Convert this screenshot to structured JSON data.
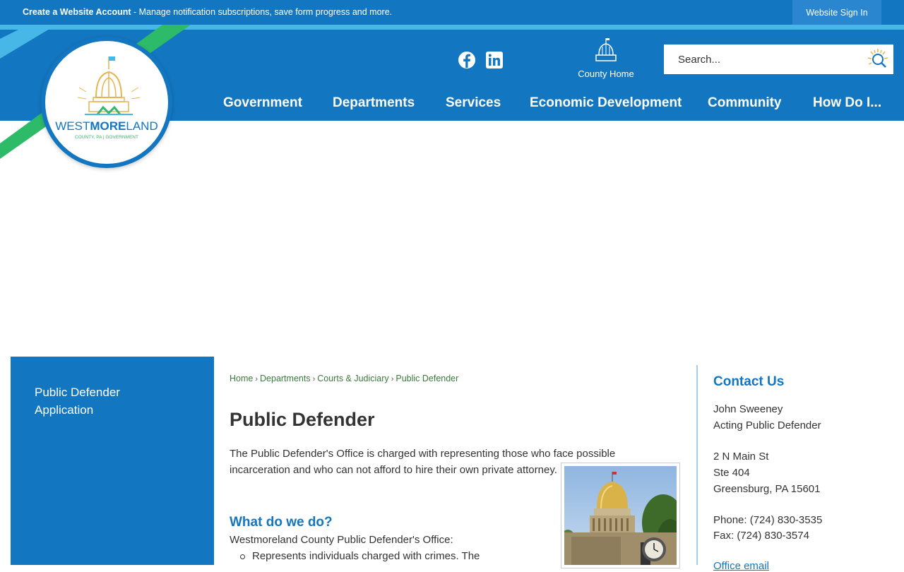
{
  "topbar": {
    "create_account": "Create a Website Account",
    "create_account_desc": " - Manage notification subscriptions, save form progress and more.",
    "sign_in": "Website Sign In"
  },
  "header": {
    "logo_text_west": "WEST",
    "logo_text_more": "MORE",
    "logo_text_land": "LAND",
    "logo_subtitle": "COUNTY, PA | GOVERNMENT",
    "social": [
      "facebook-icon",
      "linkedin-icon"
    ],
    "county_home_label": "County Home",
    "search_placeholder": "Search...",
    "nav": [
      "Government",
      "Departments",
      "Services",
      "Economic Development",
      "Community",
      "How Do I..."
    ]
  },
  "sidebar": {
    "items": [
      {
        "label": "Public Defender Application"
      }
    ]
  },
  "breadcrumb": [
    "Home",
    "Departments",
    "Courts & Judiciary",
    "Public Defender"
  ],
  "main": {
    "title": "Public Defender",
    "intro": "The Public Defender's Office is charged with representing those who face possible incarceration and who can not afford to hire their own private attorney.",
    "section_heading": "What do we do?",
    "office_line": "Westmoreland County Public Defender's Office:",
    "bullets": [
      "Represents individuals charged with crimes. The"
    ]
  },
  "contact": {
    "heading": "Contact Us",
    "name": "John Sweeney",
    "role": "Acting Public Defender",
    "address1": "2 N Main St",
    "address2": "Ste 404",
    "address3": "Greensburg, PA 15601",
    "phone": "Phone: (724) 830-3535",
    "fax": "Fax: (724) 830-3574",
    "email_partial": "Office email"
  },
  "colors": {
    "brand_blue": "#1376c0",
    "accent_light_blue": "#47b7e7",
    "accent_green": "#2dbb6a",
    "logo_gold": "#e9b44c",
    "breadcrumb_green": "#3a7a3a"
  }
}
